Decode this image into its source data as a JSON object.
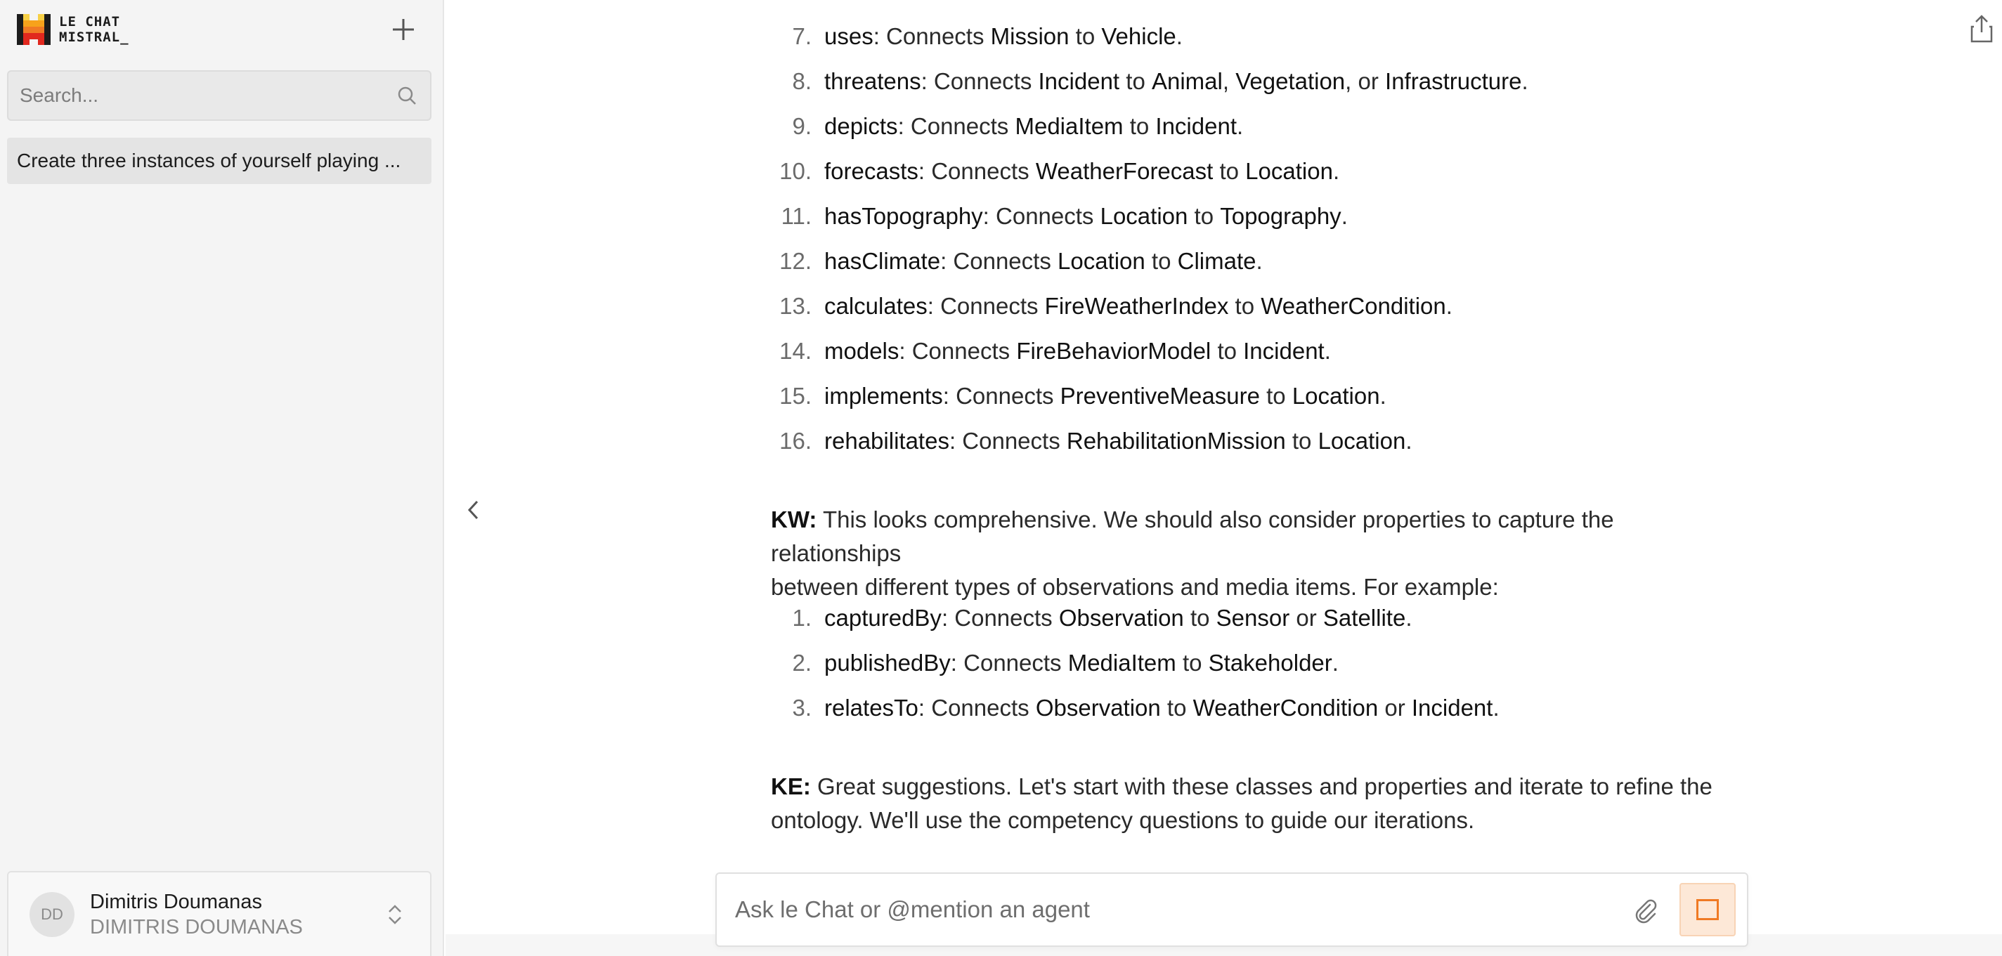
{
  "sidebar": {
    "logo_line1": "LE CHAT",
    "logo_line2": "MISTRAL_",
    "search_placeholder": "Search...",
    "chats": [
      "Create three instances of yourself playing ..."
    ],
    "user": {
      "initials": "DD",
      "name": "Dimitris Doumanas",
      "subtitle": "DIMITRIS DOUMANAS"
    }
  },
  "brand_colors": {
    "accent": "#f07a24",
    "logo_red": "#e1281e",
    "logo_orange": "#f7a21b"
  },
  "icons": [
    "plus-icon",
    "search-icon",
    "chevron-left-icon",
    "share-icon",
    "chevron-updown-icon",
    "paperclip-icon",
    "stop-icon"
  ],
  "conversation": {
    "first_list": [
      {
        "num": "7.",
        "term": "uses",
        "mid1": ": Connects ",
        "a": "Mission",
        "mid2": " to ",
        "b": "Vehicle",
        "end": "."
      },
      {
        "num": "8.",
        "term": "threatens",
        "mid1": ": Connects ",
        "a": "Incident",
        "mid2": " to ",
        "b": "Animal",
        "mid3": ", ",
        "c": "Vegetation",
        "mid4": ", or ",
        "d": "Infrastructure",
        "end": "."
      },
      {
        "num": "9.",
        "term": "depicts",
        "mid1": ": Connects ",
        "a": "MediaItem",
        "mid2": " to ",
        "b": "Incident",
        "end": "."
      },
      {
        "num": "10.",
        "term": "forecasts",
        "mid1": ": Connects ",
        "a": "WeatherForecast",
        "mid2": " to ",
        "b": "Location",
        "end": "."
      },
      {
        "num": "11.",
        "term": "hasTopography",
        "mid1": ": Connects ",
        "a": "Location",
        "mid2": " to ",
        "b": "Topography",
        "end": "."
      },
      {
        "num": "12.",
        "term": "hasClimate",
        "mid1": ": Connects ",
        "a": "Location",
        "mid2": " to ",
        "b": "Climate",
        "end": "."
      },
      {
        "num": "13.",
        "term": "calculates",
        "mid1": ": Connects ",
        "a": "FireWeatherIndex",
        "mid2": " to ",
        "b": "WeatherCondition",
        "end": "."
      },
      {
        "num": "14.",
        "term": "models",
        "mid1": ": Connects ",
        "a": "FireBehaviorModel",
        "mid2": " to ",
        "b": "Incident",
        "end": "."
      },
      {
        "num": "15.",
        "term": "implements",
        "mid1": ": Connects ",
        "a": "PreventiveMeasure",
        "mid2": " to ",
        "b": "Location",
        "end": "."
      },
      {
        "num": "16.",
        "term": "rehabilitates",
        "mid1": ": Connects ",
        "a": "RehabilitationMission",
        "mid2": " to ",
        "b": "Location",
        "end": "."
      }
    ],
    "kw_speaker": "KW:",
    "kw_line1": " This looks comprehensive. We should also consider properties to capture the relationships",
    "kw_line2": "between different types of observations and media items. For example:",
    "second_list": [
      {
        "num": "1.",
        "term": "capturedBy",
        "mid1": ": Connects ",
        "a": "Observation",
        "mid2": " to ",
        "b": "Sensor",
        "mid3": " or ",
        "c": "Satellite",
        "end": "."
      },
      {
        "num": "2.",
        "term": "publishedBy",
        "mid1": ": Connects ",
        "a": "MediaItem",
        "mid2": " to ",
        "b": "Stakeholder",
        "end": "."
      },
      {
        "num": "3.",
        "term": "relatesTo",
        "mid1": ": Connects ",
        "a": "Observation",
        "mid2": " to ",
        "b": "WeatherCondition",
        "mid3": " or ",
        "c": "Incident",
        "end": "."
      }
    ],
    "ke_speaker": "KE:",
    "ke_line1": " Great suggestions. Let's start with these classes and properties and iterate to refine the",
    "ke_line2": "ontology. We'll use the competency questions to guide our iterations."
  },
  "composer": {
    "placeholder": "Ask le Chat or @mention an agent"
  }
}
